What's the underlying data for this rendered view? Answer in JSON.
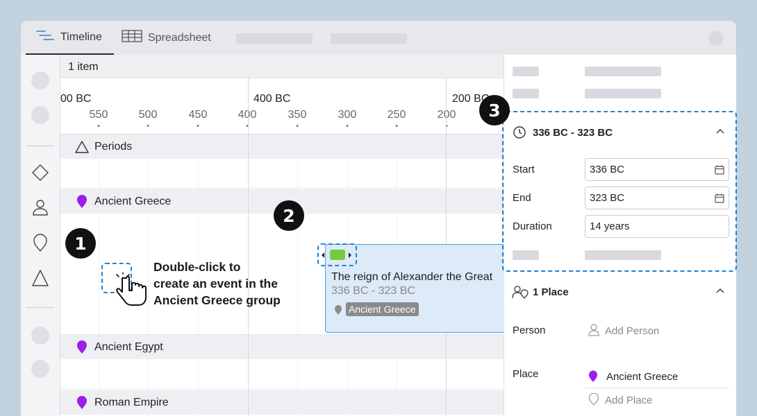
{
  "tabs": {
    "timeline_label": "Timeline",
    "spreadsheet_label": "Spreadsheet"
  },
  "timeline": {
    "item_count": "1 item",
    "scale_major": [
      "00 BC",
      "400 BC",
      "200 BC"
    ],
    "scale_minor": [
      "550",
      "500",
      "450",
      "400",
      "350",
      "300",
      "250",
      "200"
    ],
    "groups": [
      "Periods",
      "Ancient Greece",
      "Ancient Egypt",
      "Roman Empire"
    ]
  },
  "event": {
    "title": "The reign of Alexander the Great",
    "dates": "336 BC - 323 BC",
    "group_tag": "Ancient Greece",
    "color": "#7ac943"
  },
  "callout": {
    "step1": "1",
    "step2": "2",
    "step3": "3",
    "text_line1": "Double-click to",
    "text_line2": "create an event in the",
    "text_line3": "Ancient Greece group"
  },
  "details": {
    "date_section_title": "336 BC - 323 BC",
    "start_label": "Start",
    "start_value": "336 BC",
    "end_label": "End",
    "end_value": "323 BC",
    "duration_label": "Duration",
    "duration_value": "14 years",
    "place_section_title": "1 Place",
    "person_label": "Person",
    "add_person": "Add Person",
    "place_label": "Place",
    "place_value": "Ancient Greece",
    "add_place": "Add Place"
  },
  "colors": {
    "group_pin": "#9b1fe8",
    "accent_dashed": "#1e82d4",
    "event_bg": "#ddeaf8",
    "event_border": "#4b97e0"
  }
}
